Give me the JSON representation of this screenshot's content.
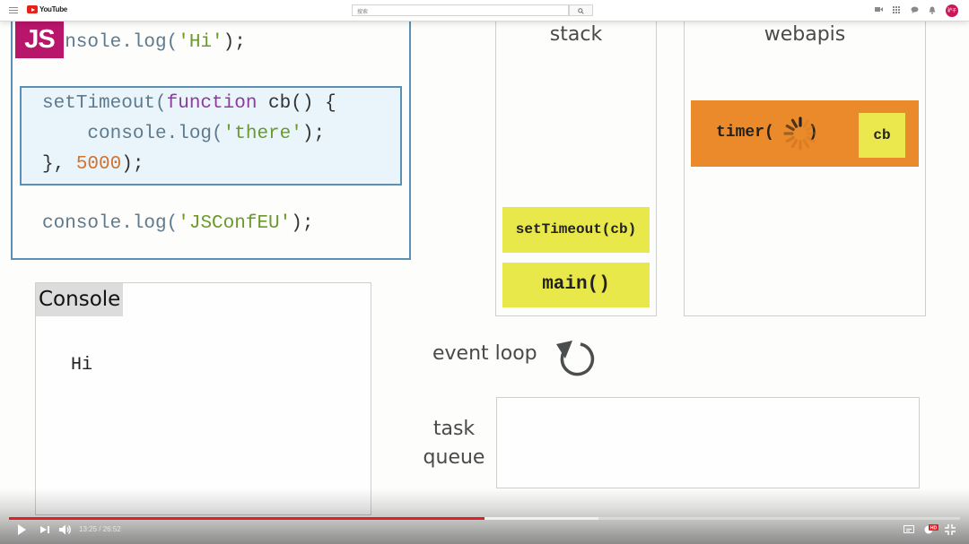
{
  "browser": {
    "site_name": "YouTube",
    "search_placeholder": "搜索",
    "search_button_icon": "search-icon",
    "top_icons": [
      "create-video-icon",
      "apps-grid-icon",
      "messages-icon",
      "notifications-bell-icon"
    ],
    "avatar_text": "驴子"
  },
  "slide": {
    "badge": "JS",
    "code_lines": {
      "line1": {
        "fn": "console.log(",
        "str": "'Hi'",
        "end": ");"
      },
      "timeout": {
        "l1_a": "setTimeout(",
        "l1_kw": "function",
        "l1_b": " cb() {",
        "l2_a": "    console.log(",
        "l2_str": "'there'",
        "l2_b": ");",
        "l3_a": "}, ",
        "l3_num": "5000",
        "l3_b": ");"
      },
      "line3": {
        "fn": "console.log(",
        "str": "'JSConfEU'",
        "end": ");"
      }
    },
    "console": {
      "title": "Console",
      "output": [
        "Hi"
      ]
    },
    "stack": {
      "title": "stack",
      "frames": [
        "setTimeout(cb)",
        "main()"
      ]
    },
    "webapis": {
      "title": "webapis",
      "timer_label": "timer(",
      "timer_close": ")",
      "callback": "cb"
    },
    "event_loop": {
      "label": "event loop"
    },
    "task_queue": {
      "label_line1": "task",
      "label_line2": "queue",
      "items": []
    },
    "colors": {
      "badge": "#b8166a",
      "code_border": "#5b8fb4",
      "highlight_bg": "#eaf5fb",
      "keyword": "#8e3a9e",
      "string": "#6a9a2c",
      "number": "#d1722e",
      "stack_frame": "#e9e84a",
      "timer": "#ea8a2a"
    }
  },
  "player": {
    "current_time": "13:25",
    "separator": " / ",
    "duration": "26:52",
    "played_fraction": 0.4996,
    "buffered_fraction": 0.62,
    "progress_color": "#e21f26",
    "quality_badge": "HD",
    "buttons": [
      "play-icon",
      "next-icon",
      "volume-icon",
      "subtitles-icon",
      "settings-icon",
      "exit-fullscreen-icon"
    ]
  }
}
